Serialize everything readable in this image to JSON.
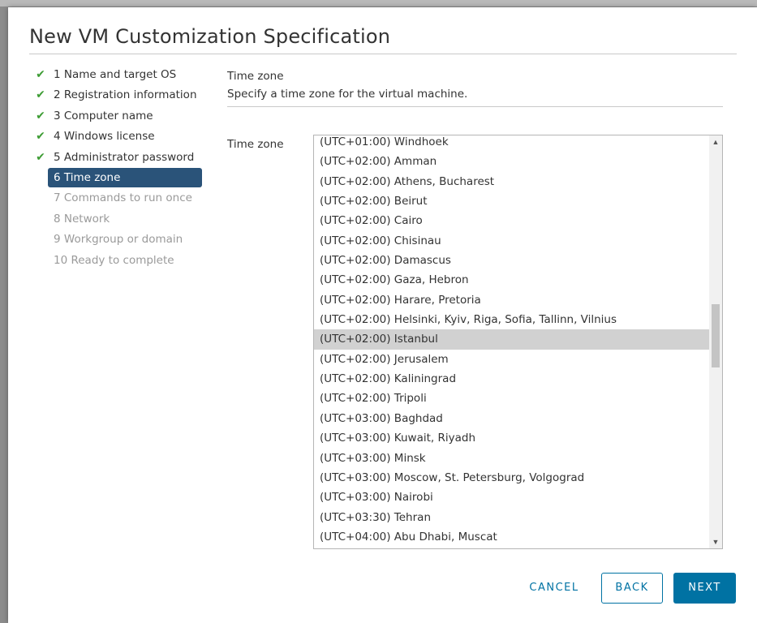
{
  "dialog": {
    "title": "New VM Customization Specification"
  },
  "steps": [
    {
      "label": "1 Name and target OS",
      "state": "done"
    },
    {
      "label": "2 Registration information",
      "state": "done"
    },
    {
      "label": "3 Computer name",
      "state": "done"
    },
    {
      "label": "4 Windows license",
      "state": "done"
    },
    {
      "label": "5 Administrator password",
      "state": "done"
    },
    {
      "label": "6 Time zone",
      "state": "active"
    },
    {
      "label": "7 Commands to run once",
      "state": "pending"
    },
    {
      "label": "8 Network",
      "state": "pending"
    },
    {
      "label": "9 Workgroup or domain",
      "state": "pending"
    },
    {
      "label": "10 Ready to complete",
      "state": "pending"
    }
  ],
  "check_glyph": "✔",
  "section": {
    "title": "Time zone",
    "description": "Specify a time zone for the virtual machine."
  },
  "timezone": {
    "label": "Time zone",
    "selected": "(UTC+02:00) Istanbul",
    "options": [
      "(UTC+01:00) Windhoek",
      "(UTC+02:00) Amman",
      "(UTC+02:00) Athens, Bucharest",
      "(UTC+02:00) Beirut",
      "(UTC+02:00) Cairo",
      "(UTC+02:00) Chisinau",
      "(UTC+02:00) Damascus",
      "(UTC+02:00) Gaza, Hebron",
      "(UTC+02:00) Harare, Pretoria",
      "(UTC+02:00) Helsinki, Kyiv, Riga, Sofia, Tallinn, Vilnius",
      "(UTC+02:00) Istanbul",
      "(UTC+02:00) Jerusalem",
      "(UTC+02:00) Kaliningrad",
      "(UTC+02:00) Tripoli",
      "(UTC+03:00) Baghdad",
      "(UTC+03:00) Kuwait, Riyadh",
      "(UTC+03:00) Minsk",
      "(UTC+03:00) Moscow, St. Petersburg, Volgograd",
      "(UTC+03:00) Nairobi",
      "(UTC+03:30) Tehran",
      "(UTC+04:00) Abu Dhabi, Muscat"
    ]
  },
  "buttons": {
    "cancel": "CANCEL",
    "back": "BACK",
    "next": "NEXT"
  },
  "colors": {
    "accent": "#0072a3",
    "active_step": "#2a5379",
    "check": "#3d9c34",
    "selected_row": "#d1d1d1"
  }
}
